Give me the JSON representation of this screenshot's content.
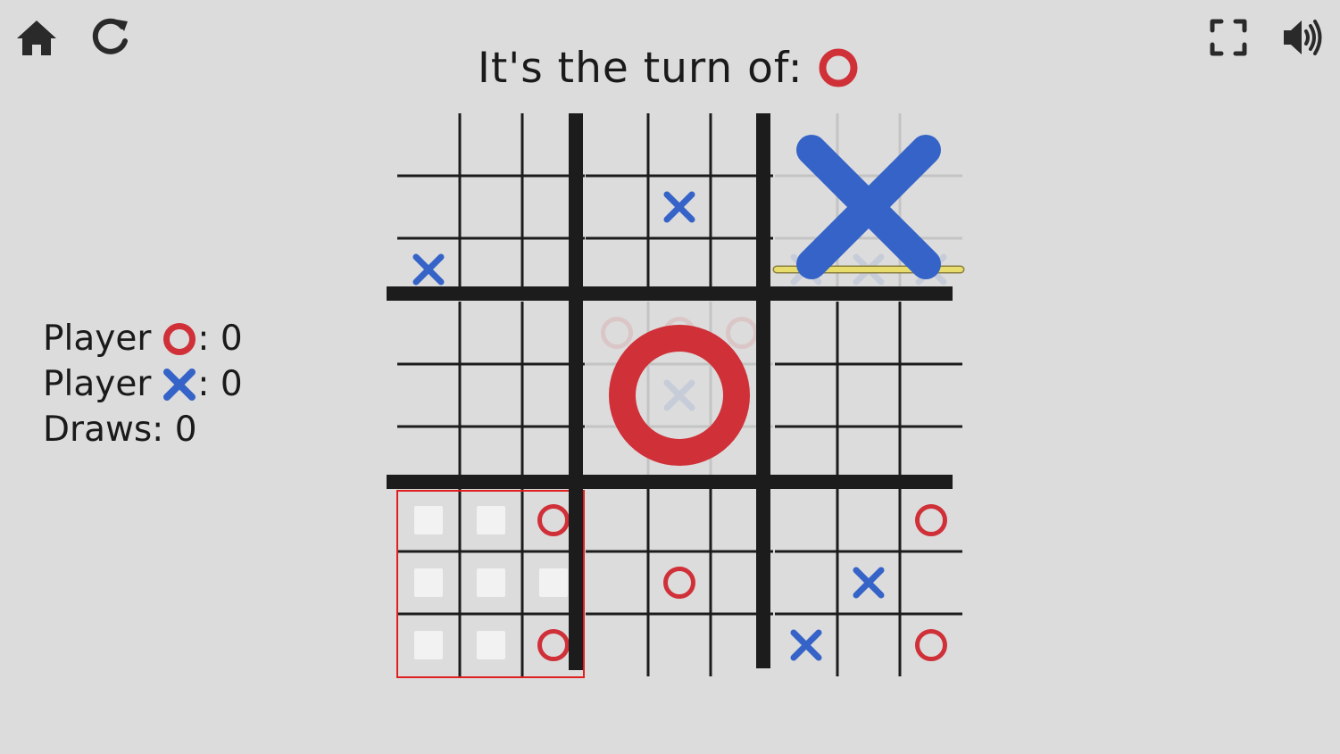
{
  "toolbar": {
    "home_icon": "home-icon",
    "restart_icon": "restart-icon",
    "fullscreen_icon": "fullscreen-icon",
    "sound_icon": "speaker-volume-icon"
  },
  "status": {
    "turn_text": "It's the turn of:",
    "turn_symbol": "O"
  },
  "scores": {
    "player_label": "Player",
    "o_score_text": ": 0",
    "x_score_text": ": 0",
    "draws_text": "Draws: 0"
  },
  "colors": {
    "background": "#dcdcdc",
    "o_color": "#d03038",
    "x_color": "#3563c8",
    "line_color": "#1c1c1c",
    "active_board_border": "#e02020",
    "win_line": "#e8dc6c",
    "available_cell": "#f2f2f2"
  },
  "game": {
    "note": "boards[i] is small board i (row-major); each holds 9 cells row-major",
    "boards": [
      [
        "",
        "",
        "",
        "",
        "",
        "",
        "X",
        "",
        ""
      ],
      [
        "",
        "",
        "",
        "",
        "X",
        "",
        "",
        "",
        ""
      ],
      [
        "",
        "",
        "",
        "",
        "",
        "",
        "X",
        "X",
        "X"
      ],
      [
        "",
        "",
        "",
        "",
        "",
        "",
        "",
        "",
        ""
      ],
      [
        "O",
        "O",
        "O",
        "",
        "X",
        "",
        "",
        "",
        ""
      ],
      [
        "",
        "",
        "",
        "",
        "",
        "",
        "",
        "",
        ""
      ],
      [
        "",
        "",
        "O",
        "",
        "",
        "",
        "",
        "",
        "O"
      ],
      [
        "",
        "",
        "",
        "",
        "O",
        "",
        "",
        "",
        ""
      ],
      [
        "",
        "",
        "O",
        "",
        "X",
        "",
        "X",
        "",
        "O"
      ]
    ],
    "board_winners": [
      "",
      "",
      "X",
      "",
      "O",
      "",
      "",
      "",
      ""
    ],
    "active_board": 6,
    "win_line_board": 2,
    "win_line_row": 2
  }
}
